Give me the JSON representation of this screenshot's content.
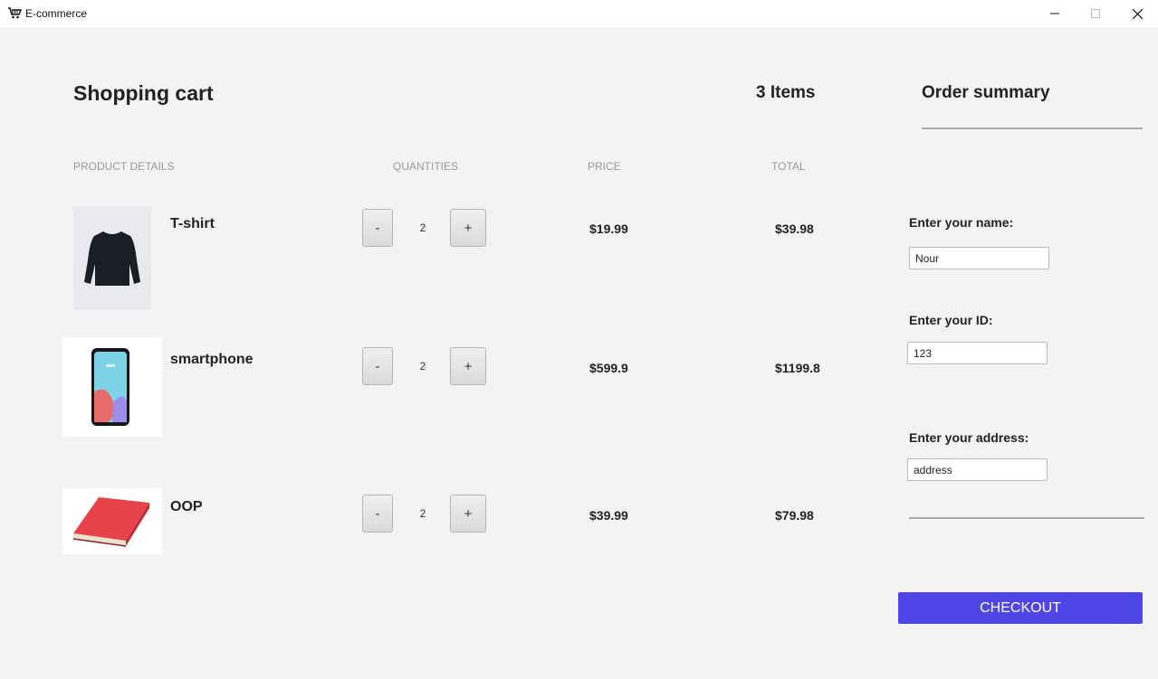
{
  "window": {
    "title": "E-commerce",
    "icons": [
      "cart-app-icon",
      "minimize-icon",
      "maximize-icon",
      "close-icon"
    ]
  },
  "cart": {
    "title": "Shopping cart",
    "item_count": "3 Items",
    "columns": {
      "details": "PRODUCT DETAILS",
      "quantities": "QUANTITIES",
      "price": "PRICE",
      "total": "TOTAL"
    },
    "decrement_label": "-",
    "increment_label": "+",
    "items": [
      {
        "name": "T-shirt",
        "quantity": "2",
        "price": "$19.99",
        "total": "$39.98",
        "image": "tshirt-image"
      },
      {
        "name": "smartphone",
        "quantity": "2",
        "price": "$599.9",
        "total": "$1199.8",
        "image": "smartphone-image"
      },
      {
        "name": "OOP",
        "quantity": "2",
        "price": "$39.99",
        "total": "$79.98",
        "image": "book-image"
      }
    ]
  },
  "summary": {
    "title": "Order summary",
    "name_label": "Enter your name:",
    "name_value": "Nour",
    "id_label": "Enter your ID:",
    "id_value": "123",
    "address_label": "Enter your address:",
    "address_value": "address",
    "checkout_label": "CHECKOUT"
  },
  "colors": {
    "accent": "#4f46e5",
    "background": "#f3f3f3",
    "titlebar": "#ffffff"
  }
}
